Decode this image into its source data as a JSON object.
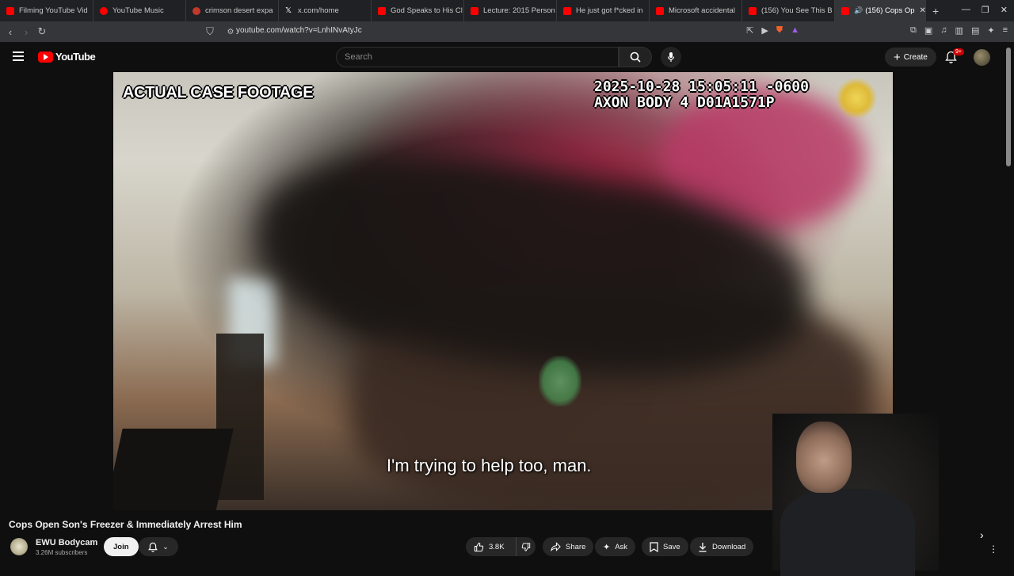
{
  "browser": {
    "tabs": [
      {
        "label": "Filming YouTube Vid",
        "color": "#ff0000"
      },
      {
        "label": "YouTube Music",
        "color": "#ff0000"
      },
      {
        "label": "crimson desert expa",
        "color": "#c0392b"
      },
      {
        "label": "x.com/home",
        "color": "#ffffff"
      },
      {
        "label": "God Speaks to His Cl",
        "color": "#ff0000"
      },
      {
        "label": "Lecture: 2015 Person",
        "color": "#ff0000"
      },
      {
        "label": "He just got f*cked in",
        "color": "#ff0000"
      },
      {
        "label": "Microsoft accidental",
        "color": "#ff0000"
      },
      {
        "label": "(156) You See This B",
        "color": "#ff0000"
      },
      {
        "label": "(156) Cops Op",
        "color": "#ff0000"
      }
    ],
    "url": "youtube.com/watch?v=LnhINvAtyJc"
  },
  "youtube": {
    "logo_text": "YouTube",
    "search_placeholder": "Search",
    "create_label": "Create",
    "notif_badge": "9+"
  },
  "video": {
    "overlay_title": "ACTUAL CASE FOOTAGE",
    "axon_line1": "2025-10-28 15:05:11 -0600",
    "axon_line2": "AXON BODY 4 D01A1571P",
    "subtitle": "I'm trying to help too, man."
  },
  "info": {
    "title": "Cops Open Son's Freezer & Immediately Arrest Him",
    "channel": "EWU Bodycam",
    "subscribers": "3.26M subscribers",
    "join_label": "Join",
    "likes": "3.8K",
    "share_label": "Share",
    "ask_label": "Ask",
    "save_label": "Save",
    "download_label": "Download"
  },
  "colors": {
    "accent": "#ff0000",
    "bg": "#0f0f0f"
  }
}
